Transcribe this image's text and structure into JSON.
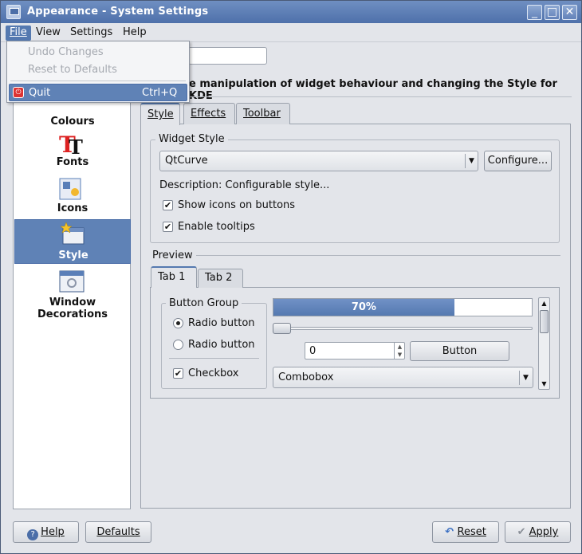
{
  "window": {
    "title": "Appearance - System Settings"
  },
  "titlebar_buttons": [
    "_",
    "□",
    "✕"
  ],
  "menubar": {
    "file": "File",
    "view": "View",
    "settings": "Settings",
    "help": "Help"
  },
  "file_menu": {
    "undo": "Undo Changes",
    "reset": "Reset to Defaults",
    "quit": "Quit",
    "quit_shortcut": "Ctrl+Q"
  },
  "heading": "e manipulation of widget behaviour and changing the Style for KDE",
  "sidebar": {
    "items": [
      {
        "label": "Colours",
        "icon": "colours-icon"
      },
      {
        "label": "Fonts",
        "icon": "fonts-icon"
      },
      {
        "label": "Icons",
        "icon": "icons-icon"
      },
      {
        "label": "Style",
        "icon": "style-icon",
        "selected": true
      },
      {
        "label": "Window Decorations",
        "icon": "window-decorations-icon"
      }
    ]
  },
  "tabs": {
    "style": "Style",
    "effects": "Effects",
    "toolbar": "Toolbar"
  },
  "widget_style": {
    "group_title": "Widget Style",
    "selected": "QtCurve",
    "configure": "Configure...",
    "description": "Description: Configurable style...",
    "show_icons": "Show icons on buttons",
    "show_icons_checked": true,
    "tooltips": "Enable tooltips",
    "tooltips_checked": true
  },
  "preview": {
    "title": "Preview",
    "tab1": "Tab 1",
    "tab2": "Tab 2",
    "button_group": "Button Group",
    "radio1": "Radio button",
    "radio2": "Radio button",
    "checkbox": "Checkbox",
    "progress_label": "70%",
    "progress": 0.7,
    "spin_value": "0",
    "button": "Button",
    "combobox": "Combobox"
  },
  "footer": {
    "help": "Help",
    "defaults": "Defaults",
    "reset": "Reset",
    "apply": "Apply"
  },
  "colors": {
    "accent": "#5579b0",
    "selection": "#5f82b6",
    "titlebar": "#5b7db6"
  }
}
